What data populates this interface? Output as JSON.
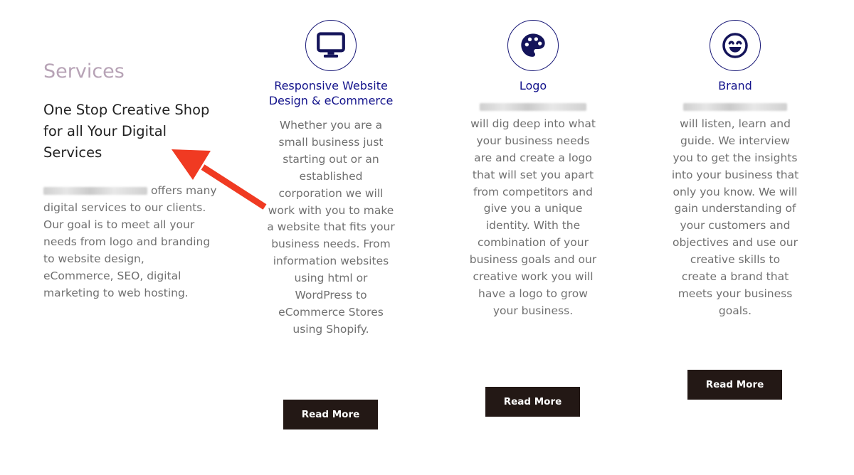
{
  "intro": {
    "kicker": "Services",
    "heading": "One Stop Creative Shop for all Your Digital Services",
    "body_suffix": "offers many digital services to our clients. Our goal is to meet all your needs from logo and branding to website design, eCommerce, SEO, digital marketing to web hosting."
  },
  "services": [
    {
      "icon": "monitor-icon",
      "title": "Responsive Website Design & eCommerce",
      "body": "Whether you are a small business just starting out or an established corporation we will work with you to make a website that fits your business needs. From information websites using html or WordPress to eCommerce Stores using Shopify.",
      "button": "Read More"
    },
    {
      "icon": "palette-icon",
      "title": "Logo",
      "body": "will dig deep into what your business needs are and create a logo that will set you apart from competitors and give you a unique identity. With the combination of your business goals and our creative work you will have a logo to grow your business.",
      "button": "Read More"
    },
    {
      "icon": "smiley-icon",
      "title": "Brand",
      "body": "will listen, learn and guide. We interview you to get the insights into your business that only you know. We will gain understanding of your customers and objectives and use our creative skills to create a brand that meets your business goals.",
      "button": "Read More"
    }
  ],
  "colors": {
    "kicker": "#b7a3b6",
    "title": "#14148c",
    "button_bg": "#231815",
    "annotation_arrow": "#f03a22"
  }
}
